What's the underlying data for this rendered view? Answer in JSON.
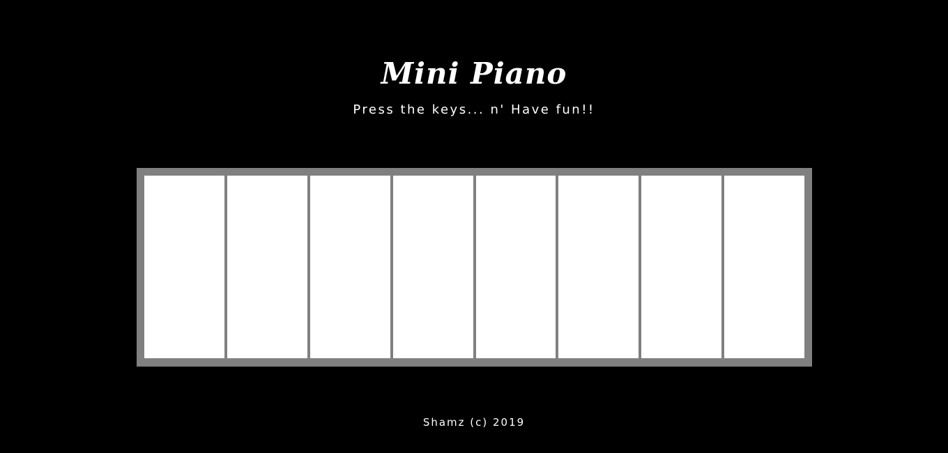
{
  "header": {
    "title": "Mini Piano",
    "subtitle": "Press the keys... n' Have fun!!"
  },
  "piano": {
    "key_count": 8,
    "key_color": "#ffffff",
    "frame_color": "#808080"
  },
  "footer": {
    "text": "Shamz (c) 2019"
  },
  "theme": {
    "background": "#000000",
    "text_color": "#ffffff"
  }
}
